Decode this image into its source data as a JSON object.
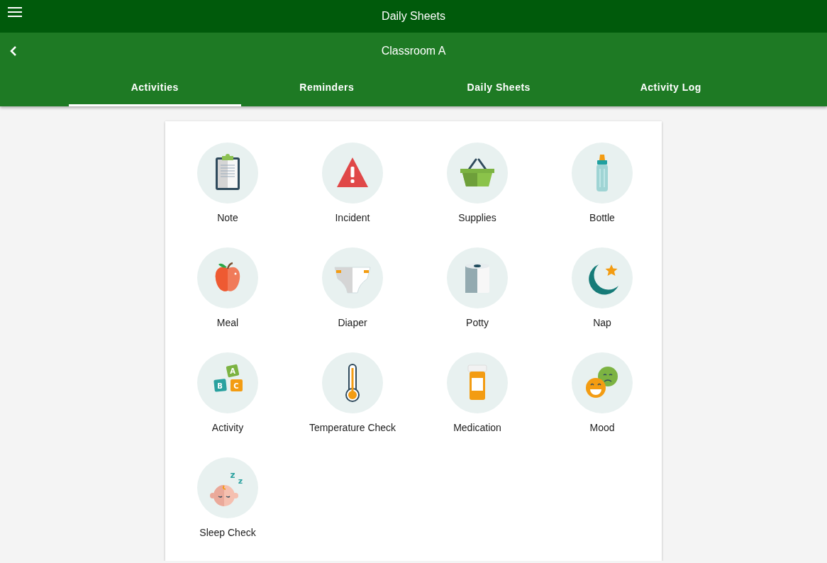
{
  "app_bar": {
    "title": "Daily Sheets"
  },
  "sub_bar": {
    "title": "Classroom A"
  },
  "tabs": [
    {
      "label": "Activities",
      "selected": true
    },
    {
      "label": "Reminders",
      "selected": false
    },
    {
      "label": "Daily Sheets",
      "selected": false
    },
    {
      "label": "Activity Log",
      "selected": false
    }
  ],
  "activities": [
    {
      "label": "Note",
      "kind": "clipboard"
    },
    {
      "label": "Incident",
      "kind": "warning"
    },
    {
      "label": "Supplies",
      "kind": "basket"
    },
    {
      "label": "Bottle",
      "kind": "bottle"
    },
    {
      "label": "Meal",
      "kind": "apple"
    },
    {
      "label": "Diaper",
      "kind": "diaper"
    },
    {
      "label": "Potty",
      "kind": "paper"
    },
    {
      "label": "Nap",
      "kind": "moon"
    },
    {
      "label": "Activity",
      "kind": "blocks",
      "letters": [
        "A",
        "B",
        "C"
      ]
    },
    {
      "label": "Temperature Check",
      "kind": "thermometer"
    },
    {
      "label": "Medication",
      "kind": "pills"
    },
    {
      "label": "Mood",
      "kind": "faces"
    },
    {
      "label": "Sleep Check",
      "kind": "baby",
      "letters": [
        "z",
        "z"
      ]
    }
  ]
}
